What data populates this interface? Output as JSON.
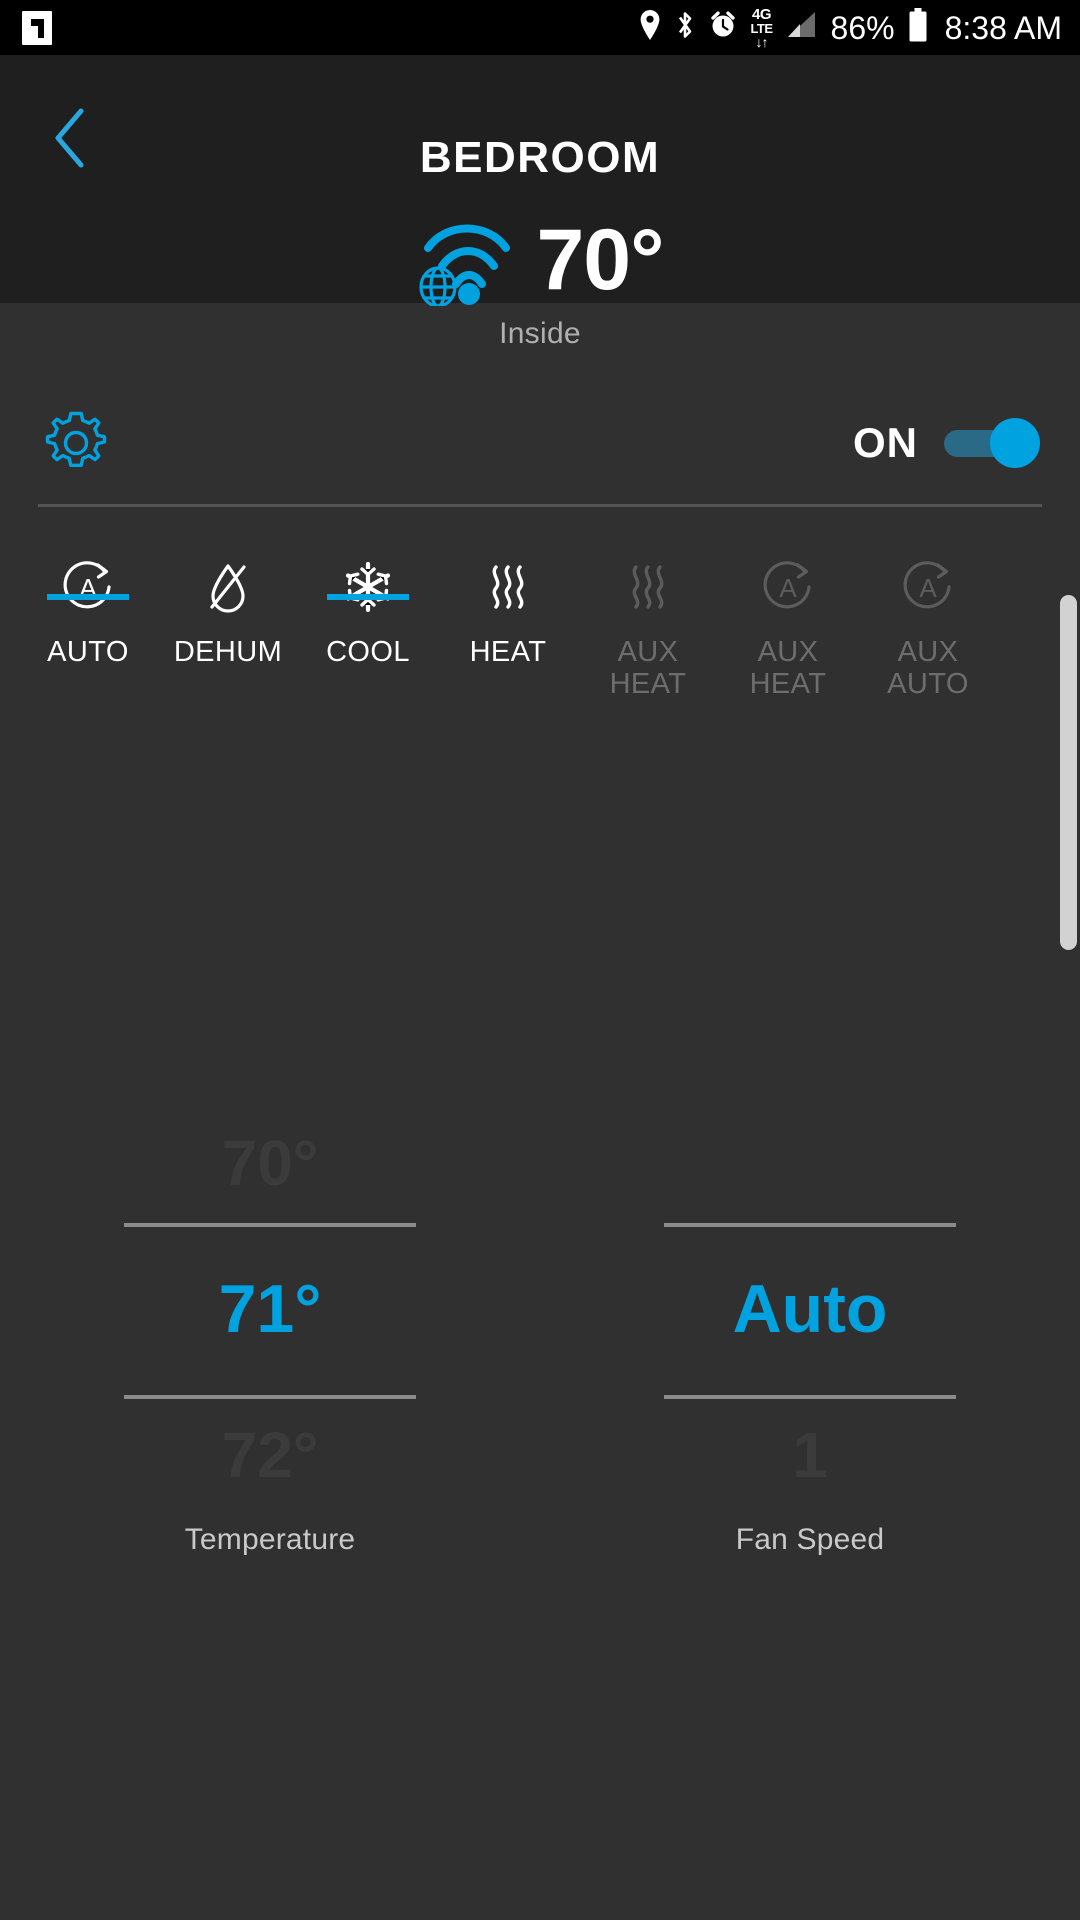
{
  "status_bar": {
    "app_icon": "flipboard-icon",
    "icons": [
      "location-pin-icon",
      "bluetooth-icon",
      "alarm-clock-icon",
      "4g-lte-data-icon",
      "cell-signal-icon"
    ],
    "network_label_top": "4G",
    "network_label_bottom": "LTE",
    "network_arrows": "↓↑",
    "battery_percent": "86%",
    "battery_icon": "battery-icon",
    "time": "8:38 AM"
  },
  "header": {
    "back_icon": "chevron-left-icon",
    "title": "BEDROOM",
    "connection_icon": "wifi-globe-icon",
    "inside_temperature": "70°",
    "inside_label": "Inside"
  },
  "controls": {
    "settings_icon": "gear-icon",
    "power_label": "ON",
    "power_state": "on"
  },
  "modes": [
    {
      "label": "AUTO",
      "icon": "auto-circle-a-icon",
      "state": "enabled",
      "active": false
    },
    {
      "label": "DEHUM",
      "icon": "dehumidify-drop-icon",
      "state": "enabled",
      "active": false
    },
    {
      "label": "COOL",
      "icon": "snowflake-icon",
      "state": "enabled",
      "active": true
    },
    {
      "label": "HEAT",
      "icon": "heat-waves-icon",
      "state": "enabled",
      "active": false
    },
    {
      "label": "AUX\nHEAT",
      "icon": "heat-waves-icon",
      "state": "disabled",
      "active": false
    },
    {
      "label": "AUX\nHEAT",
      "icon": "auto-circle-a-icon",
      "state": "disabled",
      "active": false
    },
    {
      "label": "AUX\nAUTO",
      "icon": "auto-circle-a-icon",
      "state": "disabled",
      "active": false
    }
  ],
  "pickers": [
    {
      "name": "temperature",
      "caption": "Temperature",
      "above": "70°",
      "selected": "71°",
      "below": "72°"
    },
    {
      "name": "fan-speed",
      "caption": "Fan Speed",
      "above": "",
      "selected": "Auto",
      "below": "1"
    }
  ],
  "colors": {
    "accent": "#00a3e0",
    "header_bg": "#1f1f1f",
    "panel_bg": "#303030",
    "status_bg": "#000000",
    "text_primary": "#ffffff",
    "text_muted": "#b0b0b0",
    "text_disabled": "#6d6d6d",
    "picker_dim": "#3b3b3b"
  }
}
